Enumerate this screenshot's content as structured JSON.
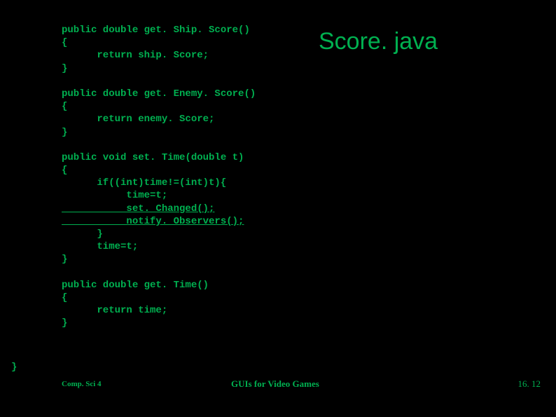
{
  "title": "Score. java",
  "code": {
    "m1_l1": "public double get. Ship. Score()",
    "m1_l2": "{",
    "m1_l3": "      return ship. Score;",
    "m1_l4": "}",
    "m2_l1": "public double get. Enemy. Score()",
    "m2_l2": "{",
    "m2_l3": "      return enemy. Score;",
    "m2_l4": "}",
    "m3_l1": "public void set. Time(double t)",
    "m3_l2": "{",
    "m3_l3": "      if((int)time!=(int)t){",
    "m3_l4": "           time=t;",
    "m3_l5": "           set. Changed();",
    "m3_l6": "           notify. Observers();",
    "m3_l7": "      }",
    "m3_l8": "      time=t;",
    "m3_l9": "}",
    "m4_l1": "public double get. Time()",
    "m4_l2": "{",
    "m4_l3": "      return time;",
    "m4_l4": "}",
    "close": "}"
  },
  "footer": {
    "left": "Comp. Sci 4",
    "center": "GUIs for Video Games",
    "right": "16. 12"
  }
}
